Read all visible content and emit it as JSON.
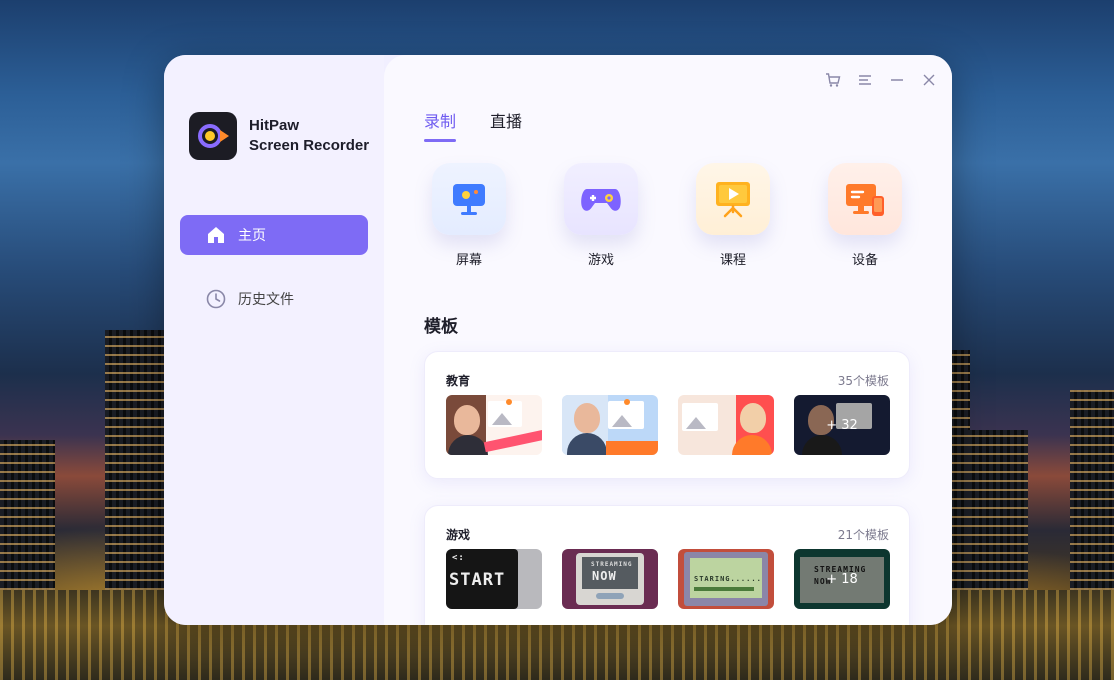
{
  "app": {
    "name_line1": "HitPaw",
    "name_line2": "Screen Recorder"
  },
  "sidebar": {
    "items": [
      {
        "label": "主页",
        "icon": "home-icon",
        "active": true
      },
      {
        "label": "历史文件",
        "icon": "clock-icon",
        "active": false
      }
    ]
  },
  "window_controls": [
    "cart-icon",
    "menu-icon",
    "minimize-icon",
    "close-icon"
  ],
  "tabs": [
    {
      "label": "录制",
      "active": true
    },
    {
      "label": "直播",
      "active": false
    }
  ],
  "modes": [
    {
      "label": "屏幕",
      "icon": "monitor-icon"
    },
    {
      "label": "游戏",
      "icon": "gamepad-icon"
    },
    {
      "label": "课程",
      "icon": "presentation-icon"
    },
    {
      "label": "设备",
      "icon": "devices-icon"
    }
  ],
  "templates": {
    "title": "模板",
    "categories": [
      {
        "title": "教育",
        "count": "35个模板",
        "more": "+ 32"
      },
      {
        "title": "游戏",
        "count": "21个模板",
        "more": "+ 18"
      }
    ]
  },
  "colors": {
    "accent": "#7e6bf5",
    "sidebar_bg": "#f3f1ff",
    "main_bg": "#faf9ff"
  }
}
